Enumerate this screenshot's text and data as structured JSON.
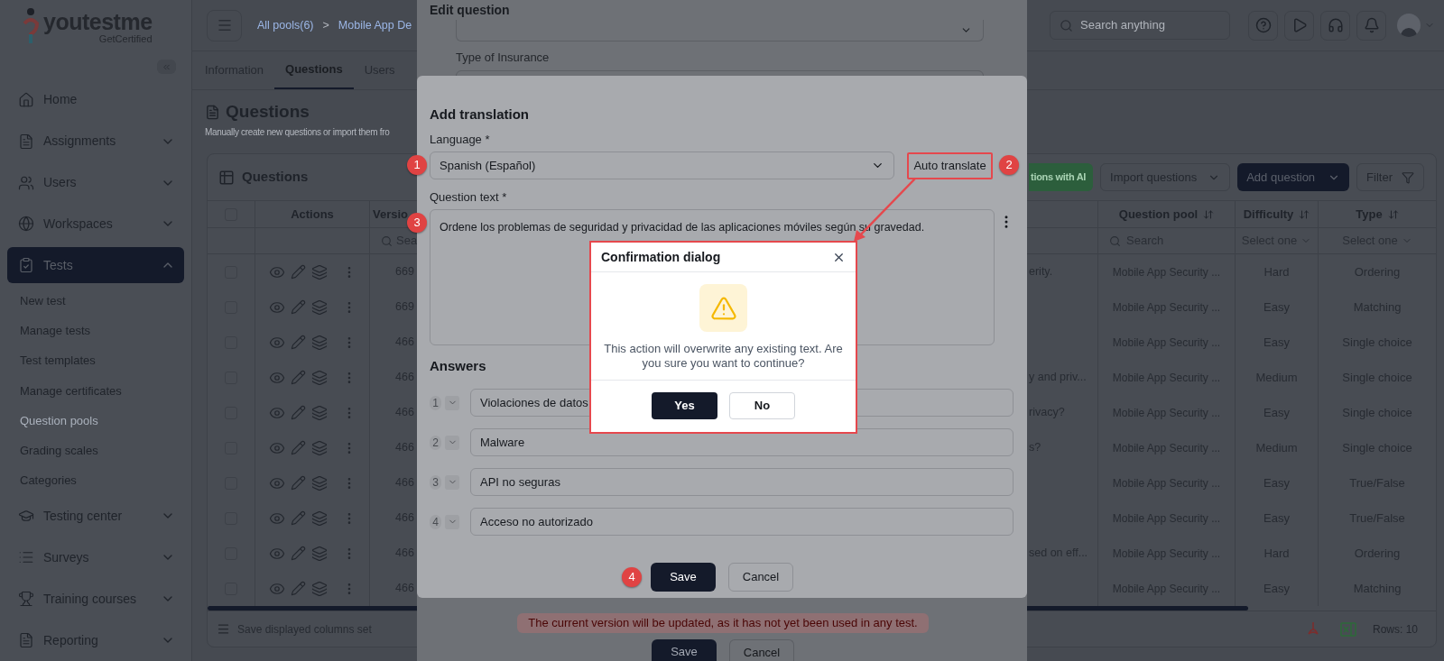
{
  "sidebar": {
    "logo": {
      "name": "youtestme",
      "tagline": "GetCertified"
    },
    "items": [
      {
        "label": "Home",
        "kind": "link",
        "selected": false
      },
      {
        "label": "Assignments",
        "kind": "group",
        "expanded": false,
        "selected": false
      },
      {
        "label": "Users",
        "kind": "group",
        "expanded": false,
        "selected": false
      },
      {
        "label": "Workspaces",
        "kind": "group",
        "expanded": false,
        "selected": false
      },
      {
        "label": "Tests",
        "kind": "group",
        "expanded": true,
        "selected": true,
        "children": [
          {
            "label": "New test",
            "selected": false
          },
          {
            "label": "Manage tests",
            "selected": false
          },
          {
            "label": "Test templates",
            "selected": false
          },
          {
            "label": "Manage certificates",
            "selected": false
          },
          {
            "label": "Question pools",
            "selected": true
          },
          {
            "label": "Grading scales",
            "selected": false
          },
          {
            "label": "Categories",
            "selected": false
          }
        ]
      },
      {
        "label": "Testing center",
        "kind": "group",
        "expanded": false,
        "selected": false
      },
      {
        "label": "Surveys",
        "kind": "group",
        "expanded": false,
        "selected": false
      },
      {
        "label": "Training courses",
        "kind": "group",
        "expanded": false,
        "selected": false
      },
      {
        "label": "Reporting",
        "kind": "group",
        "expanded": false,
        "selected": false
      }
    ]
  },
  "topbar": {
    "breadcrumbs": [
      {
        "label": "All pools(6)",
        "kind": "link"
      },
      {
        "label": ">",
        "kind": "separator"
      },
      {
        "label": "Mobile App De",
        "kind": "link"
      }
    ],
    "search_placeholder": "Search anything"
  },
  "tabs": [
    {
      "label": "Information",
      "selected": false
    },
    {
      "label": "Questions",
      "selected": true
    },
    {
      "label": "Users",
      "selected": false
    }
  ],
  "page": {
    "title": "Questions",
    "subtitle": "Manually create new questions or import them fro"
  },
  "questions_card": {
    "title": "Questions",
    "buttons": [
      {
        "label": "tions with AI",
        "kind": "ai"
      },
      {
        "label": "Import questions",
        "kind": "dropdown"
      },
      {
        "label": "Add question",
        "kind": "primary"
      },
      {
        "label": "Filter",
        "kind": "filter"
      }
    ],
    "table": {
      "select_all_checked": false,
      "actions_header": "Actions",
      "version_header": "Versio",
      "version_filter": "Sea",
      "right_columns": [
        {
          "label": "Question pool",
          "sortable": true,
          "filter": {
            "kind": "search",
            "placeholder": "Search"
          }
        },
        {
          "label": "Difficulty",
          "sortable": true,
          "filter": {
            "kind": "select",
            "placeholder": "Select one"
          }
        },
        {
          "label": "Type",
          "sortable": true,
          "filter": {
            "kind": "select",
            "placeholder": "Select one"
          }
        }
      ],
      "rows": [
        {
          "checked": false,
          "version": "669",
          "text_tail": "erity.",
          "pool": "Mobile App Security ...",
          "difficulty": "Hard",
          "type": "Ordering"
        },
        {
          "checked": false,
          "version": "669",
          "pool": "Mobile App Security ...",
          "difficulty": "Easy",
          "type": "Matching"
        },
        {
          "checked": false,
          "version": "466",
          "pool": "Mobile App Security ...",
          "difficulty": "Easy",
          "type": "Single choice"
        },
        {
          "checked": false,
          "version": "466",
          "text_tail": "y and priv...",
          "pool": "Mobile App Security ...",
          "difficulty": "Medium",
          "type": "Single choice"
        },
        {
          "checked": false,
          "version": "466",
          "text_tail": "rivacy?",
          "pool": "Mobile App Security ...",
          "difficulty": "Easy",
          "type": "Single choice"
        },
        {
          "checked": false,
          "version": "466",
          "text_tail": "s?",
          "pool": "Mobile App Security ...",
          "difficulty": "Medium",
          "type": "Single choice"
        },
        {
          "checked": false,
          "version": "466",
          "pool": "Mobile App Security ...",
          "difficulty": "Easy",
          "type": "True/False"
        },
        {
          "checked": false,
          "version": "466",
          "pool": "Mobile App Security ...",
          "difficulty": "Easy",
          "type": "True/False"
        },
        {
          "checked": false,
          "version": "466",
          "text_tail": "sed on eff...",
          "pool": "Mobile App Security ...",
          "difficulty": "Hard",
          "type": "Ordering"
        },
        {
          "checked": false,
          "version": "466",
          "pool": "Mobile App Security ...",
          "difficulty": "Easy",
          "type": "Matching"
        }
      ]
    },
    "footer": {
      "columns_label": "Save displayed columns set",
      "rows": "Rows: 10"
    }
  },
  "edit_question_modal": {
    "title": "Edit question",
    "field_label": "Type of Insurance",
    "alert": "The current version will be updated, as it has not yet been used in any test.",
    "buttons": [
      {
        "label": "Save",
        "kind": "primary"
      },
      {
        "label": "Cancel",
        "kind": "secondary"
      }
    ]
  },
  "translation_modal": {
    "title": "Add translation",
    "language_label": "Language *",
    "language_value": "Spanish (Español)",
    "language_callout": "1",
    "auto_translate": {
      "label": "Auto translate",
      "highlighted": true,
      "callout": "2"
    },
    "question_label": "Question text *",
    "question_text": "Ordene los problemas de seguridad y privacidad de las aplicaciones móviles según su gravedad.",
    "question_callout": "3",
    "answers_title": "Answers",
    "answers": [
      {
        "number": "1",
        "text": "Violaciones de datos"
      },
      {
        "number": "2",
        "text": "Malware"
      },
      {
        "number": "3",
        "text": "API no seguras"
      },
      {
        "number": "4",
        "text": "Acceso no autorizado"
      }
    ],
    "buttons": [
      {
        "label": "Save",
        "kind": "primary",
        "callout": "4"
      },
      {
        "label": "Cancel",
        "kind": "secondary"
      }
    ]
  },
  "confirmation_dialog": {
    "title": "Confirmation dialog",
    "highlighted": true,
    "message": "This action will overwrite any existing text. Are you sure you want to continue?",
    "buttons": [
      {
        "label": "Yes",
        "kind": "primary"
      },
      {
        "label": "No",
        "kind": "secondary"
      }
    ]
  }
}
